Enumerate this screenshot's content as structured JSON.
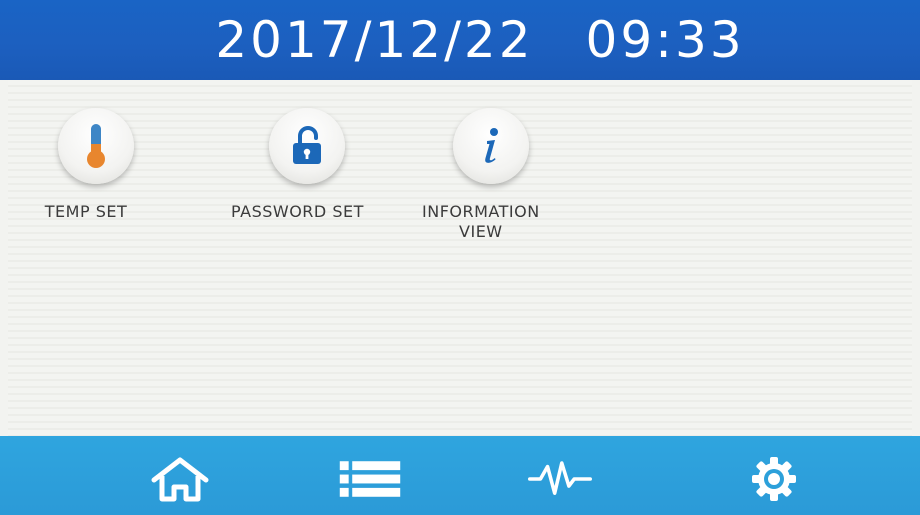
{
  "header": {
    "date": "2017/12/22",
    "time": "09:33"
  },
  "apps": [
    {
      "label": "TEMP SET",
      "icon": "thermometer-icon"
    },
    {
      "label": "PASSWORD SET",
      "icon": "unlock-icon"
    },
    {
      "label": "INFORMATION\nVIEW",
      "icon": "info-icon"
    }
  ],
  "nav": [
    {
      "icon": "home-icon"
    },
    {
      "icon": "menu-list-icon"
    },
    {
      "icon": "pulse-icon"
    },
    {
      "icon": "gear-icon"
    }
  ],
  "colors": {
    "header_bg": "#1b60c0",
    "footer_bg": "#2ca0da",
    "icon_blue": "#1c68b8",
    "thermo_orange": "#e8862e"
  }
}
